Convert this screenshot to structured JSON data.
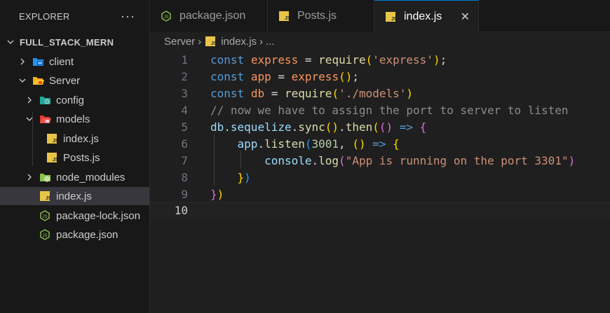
{
  "sidebar": {
    "title": "EXPLORER",
    "more": "···",
    "root": "FULL_STACK_MERN",
    "items": [
      {
        "label": "client",
        "icon": "client-folder-icon"
      },
      {
        "label": "Server",
        "icon": "server-folder-open-icon"
      },
      {
        "label": "config",
        "icon": "config-folder-icon"
      },
      {
        "label": "models",
        "icon": "models-folder-open-icon"
      },
      {
        "label": "index.js",
        "icon": "js-file-icon"
      },
      {
        "label": "Posts.js",
        "icon": "js-file-icon"
      },
      {
        "label": "node_modules",
        "icon": "node-folder-icon"
      },
      {
        "label": "index.js",
        "icon": "js-file-icon"
      },
      {
        "label": "package-lock.json",
        "icon": "nodejs-file-icon"
      },
      {
        "label": "package.json",
        "icon": "nodejs-file-icon"
      }
    ]
  },
  "tabs": [
    {
      "label": "package.json",
      "icon": "nodejs-file-icon"
    },
    {
      "label": "Posts.js",
      "icon": "js-file-icon"
    },
    {
      "label": "index.js",
      "icon": "js-file-icon",
      "close": "✕"
    }
  ],
  "breadcrumb": {
    "folder": "Server",
    "sep": "›",
    "file": "index.js",
    "rest": "..."
  },
  "editor": {
    "line_numbers": [
      "1",
      "2",
      "3",
      "4",
      "5",
      "6",
      "7",
      "8",
      "9",
      "10"
    ],
    "line4_comment": "// now we have to assign the port to server to listen",
    "strings": {
      "express": "'express'",
      "models": "'./models'",
      "message": "\"App is running on the port 3301\""
    },
    "port": "3001"
  },
  "colors": {
    "accent": "#0078d4",
    "js_icon": "#e8c547",
    "node_icon": "#8bc34a"
  }
}
